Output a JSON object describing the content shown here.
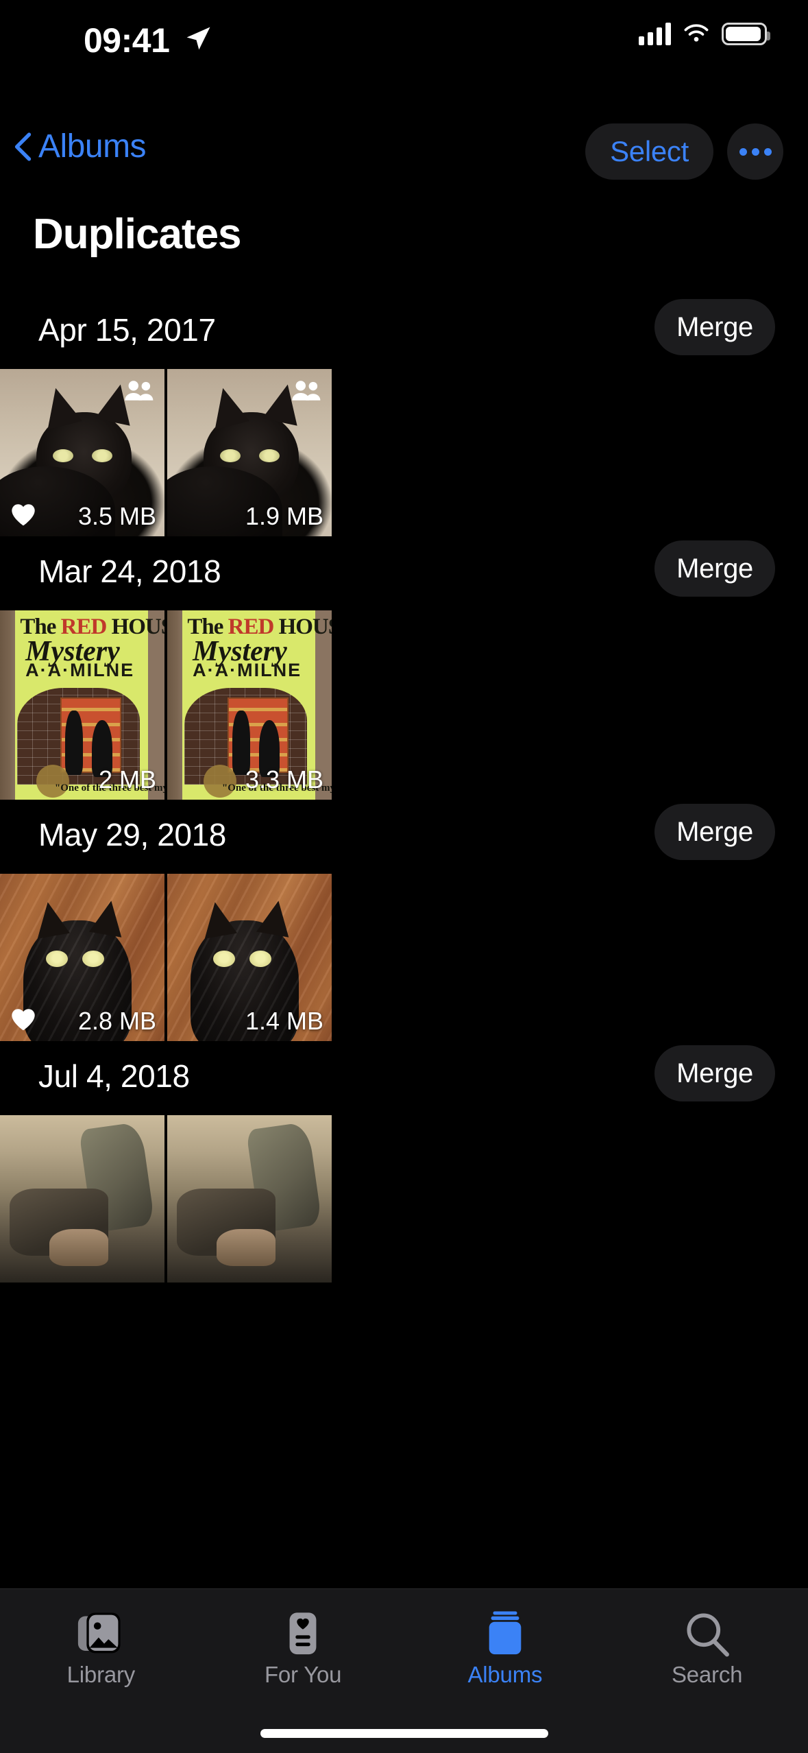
{
  "status_bar": {
    "time": "09:41",
    "location_icon": "location-arrow-icon",
    "cellular_icon": "cellular-bars-icon",
    "wifi_icon": "wifi-icon",
    "battery_icon": "battery-icon"
  },
  "nav": {
    "back_label": "Albums",
    "back_icon": "chevron-left-icon",
    "select_label": "Select",
    "more_icon": "ellipsis-icon"
  },
  "page_title": "Duplicates",
  "groups": [
    {
      "date": "Apr 15, 2017",
      "merge_label": "Merge",
      "photos": [
        {
          "size": "3.5 MB",
          "favorite": true,
          "shared": true,
          "subject": "black-cat-on-carpet"
        },
        {
          "size": "1.9 MB",
          "favorite": false,
          "shared": true,
          "subject": "black-cat-on-carpet"
        }
      ]
    },
    {
      "date": "Mar 24, 2018",
      "merge_label": "Merge",
      "photos": [
        {
          "size": "2 MB",
          "favorite": false,
          "shared": false,
          "subject": "book-cover-red-house-mystery"
        },
        {
          "size": "3.3 MB",
          "favorite": false,
          "shared": false,
          "subject": "book-cover-red-house-mystery"
        }
      ],
      "book": {
        "title_line1_pre": "The ",
        "title_line1_accent": "RED",
        "title_line1_post": " HOUSE",
        "title_line2": "Mystery",
        "author": "A·A·MILNE",
        "tagline": "\"One of the three best mystery stories of all time.\""
      }
    },
    {
      "date": "May 29, 2018",
      "merge_label": "Merge",
      "photos": [
        {
          "size": "2.8 MB",
          "favorite": true,
          "shared": false,
          "subject": "black-cat-on-wood-floor"
        },
        {
          "size": "1.4 MB",
          "favorite": false,
          "shared": false,
          "subject": "black-cat-on-wood-floor"
        }
      ]
    },
    {
      "date": "Jul 4, 2018",
      "merge_label": "Merge",
      "photos": [
        {
          "size": "",
          "favorite": false,
          "shared": false,
          "subject": "rocky-outdoor-scene"
        },
        {
          "size": "",
          "favorite": false,
          "shared": false,
          "subject": "rocky-outdoor-scene"
        }
      ]
    }
  ],
  "tabs": [
    {
      "label": "Library",
      "icon": "photo-stack-icon",
      "active": false
    },
    {
      "label": "For You",
      "icon": "for-you-card-icon",
      "active": false
    },
    {
      "label": "Albums",
      "icon": "albums-book-icon",
      "active": true
    },
    {
      "label": "Search",
      "icon": "magnifier-icon",
      "active": false
    }
  ],
  "colors": {
    "accent_blue": "#3b82f6",
    "background": "#000000",
    "control_surface": "#1c1c1e",
    "inactive_tab": "#98989f"
  }
}
